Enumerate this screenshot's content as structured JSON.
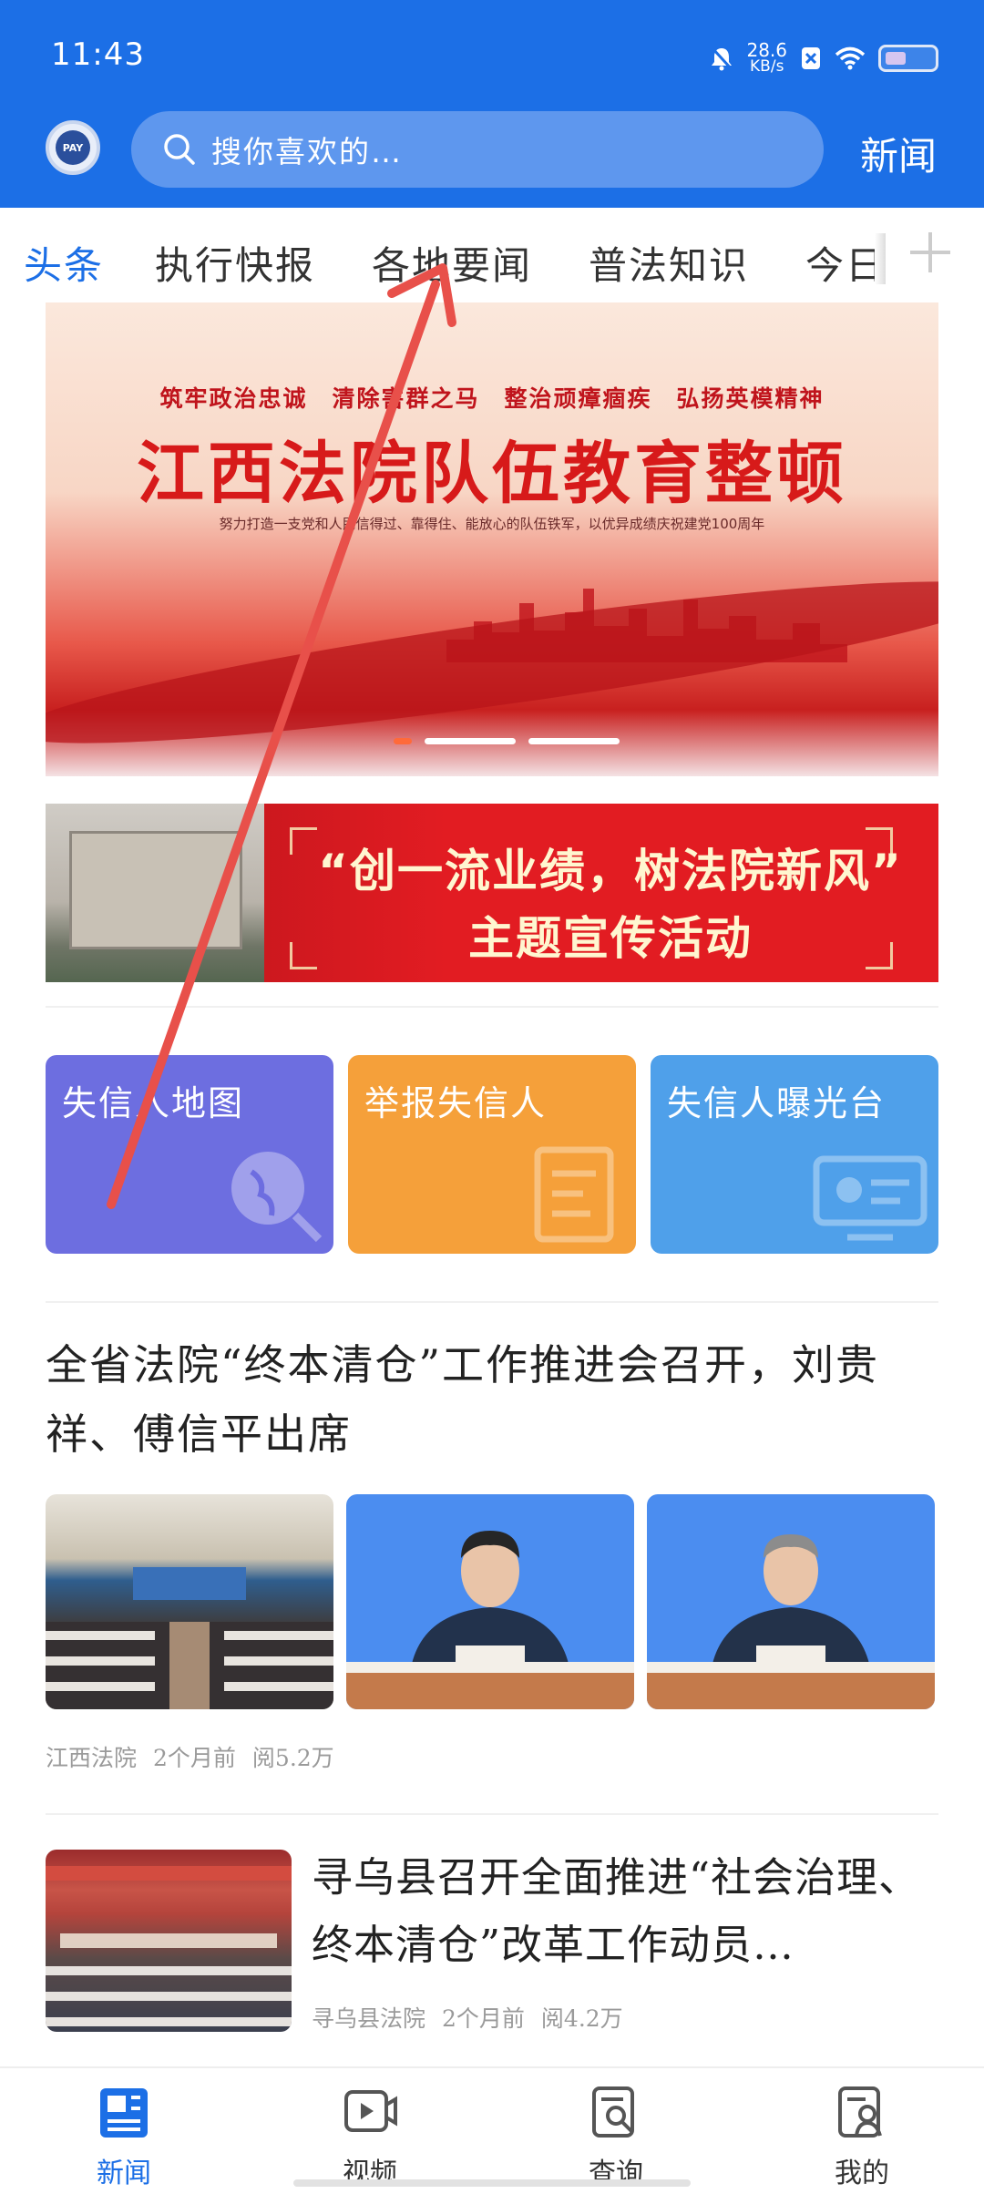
{
  "status_bar": {
    "time": "11:43",
    "net_speed_value": "28.6",
    "net_speed_unit": "KB/s"
  },
  "header": {
    "search_placeholder": "搜你喜欢的…",
    "right_label": "新闻"
  },
  "tabs": [
    "头条",
    "执行快报",
    "各地要闻",
    "普法知识",
    "今日"
  ],
  "active_tab": 0,
  "banner": {
    "slogan": "筑牢政治忠诚　清除害群之马　整治顽瘴痼疾　弘扬英模精神",
    "title": "江西法院队伍教育整顿",
    "subtitle": "努力打造一支党和人民信得过、靠得住、能放心的队伍铁军，以优异成绩庆祝建党100周年",
    "page_index": 0,
    "page_count": 3
  },
  "banner2": {
    "line1": "“创一流业绩，树法院新风”",
    "line2": "主题宣传活动"
  },
  "features": [
    {
      "label": "失信人地图",
      "color": "#6d6ee0",
      "icon": "map-globe-icon"
    },
    {
      "label": "举报失信人",
      "color": "#f5a03a",
      "icon": "report-document-icon"
    },
    {
      "label": "失信人曝光台",
      "color": "#4fa0ea",
      "icon": "exposure-screen-icon"
    }
  ],
  "news": [
    {
      "title": "全省法院“终本清仓”工作推进会召开，刘贵祥、傅信平出席",
      "source": "江西法院",
      "time": "2个月前",
      "reads": "阅5.2万"
    },
    {
      "title": "寻乌县召开全面推进“社会治理、终本清仓”改革工作动员…",
      "source": "寻乌县法院",
      "time": "2个月前",
      "reads": "阅4.2万"
    }
  ],
  "bottom_nav": [
    {
      "label": "新闻",
      "icon": "news-icon"
    },
    {
      "label": "视频",
      "icon": "video-icon"
    },
    {
      "label": "查询",
      "icon": "query-icon"
    },
    {
      "label": "我的",
      "icon": "profile-icon"
    }
  ],
  "active_nav": 0,
  "colors": {
    "primary": "#1c6fe6",
    "banner_red": "#d71a1a",
    "annotation": "#e8504a"
  }
}
